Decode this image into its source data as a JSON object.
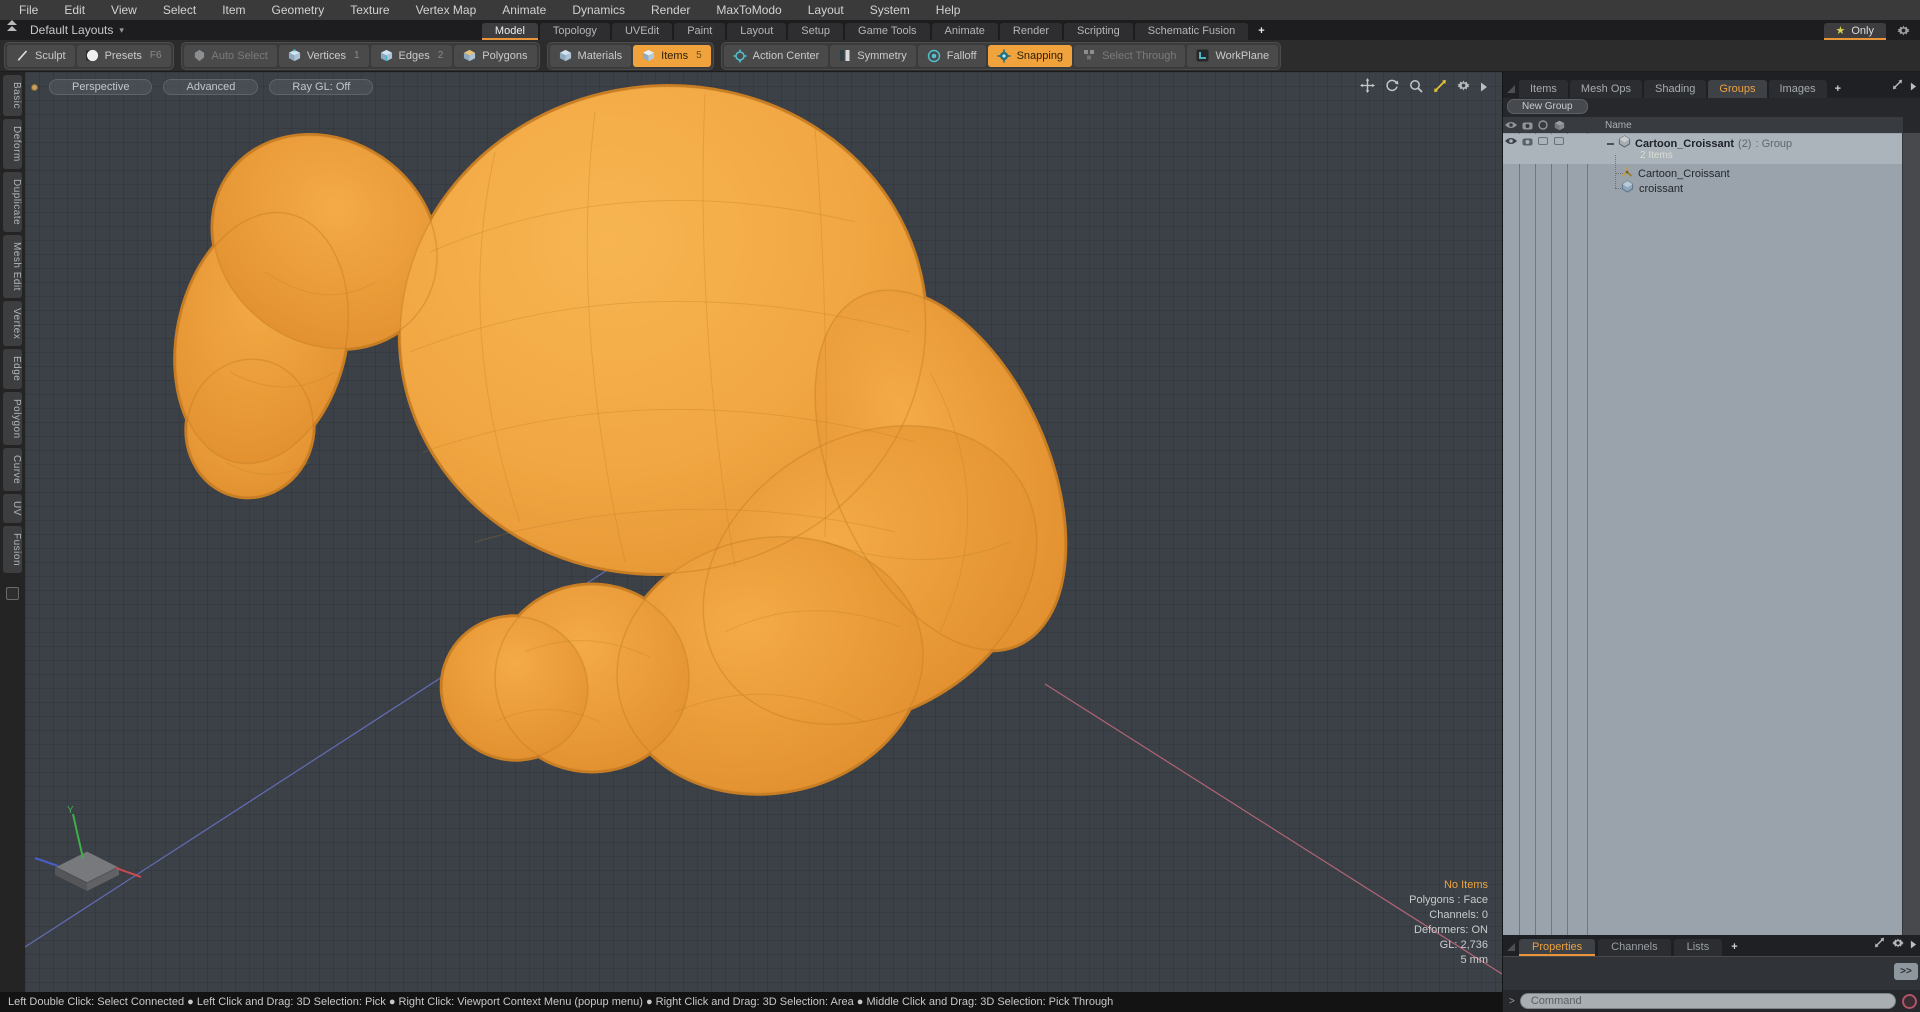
{
  "menubar": {
    "items": [
      "File",
      "Edit",
      "View",
      "Select",
      "Item",
      "Geometry",
      "Texture",
      "Vertex Map",
      "Animate",
      "Dynamics",
      "Render",
      "MaxToModo",
      "Layout",
      "System",
      "Help"
    ]
  },
  "layout_bar": {
    "layouts_label": "Default Layouts",
    "tabs": [
      "Model",
      "Topology",
      "UVEdit",
      "Paint",
      "Layout",
      "Setup",
      "Game Tools",
      "Animate",
      "Render",
      "Scripting",
      "Schematic Fusion"
    ],
    "add_tab_label": "+",
    "only_label": "Only"
  },
  "toolbar": {
    "buttons": [
      {
        "label": "Sculpt"
      },
      {
        "label": "Presets",
        "shortcut": "F6"
      },
      {
        "label": "Auto Select"
      },
      {
        "label": "Vertices",
        "shortcut": "1"
      },
      {
        "label": "Edges",
        "shortcut": "2"
      },
      {
        "label": "Polygons"
      },
      {
        "label": "Materials"
      },
      {
        "label": "Items",
        "shortcut": "5"
      },
      {
        "label": "Action Center"
      },
      {
        "label": "Symmetry"
      },
      {
        "label": "Falloff"
      },
      {
        "label": "Snapping"
      },
      {
        "label": "Select Through"
      },
      {
        "label": "WorkPlane"
      }
    ]
  },
  "left_tabs": {
    "items": [
      "Basic",
      "Deform",
      "Duplicate",
      "Mesh Edit",
      "Vertex",
      "Edge",
      "Polygon",
      "Curve",
      "UV",
      "Fusion"
    ]
  },
  "viewport": {
    "buttons": [
      "Perspective",
      "Advanced",
      "Ray GL: Off"
    ],
    "axis_y_label": "Y",
    "hud": {
      "selection": "No Items",
      "lines": [
        "Polygons : Face",
        "Channels: 0",
        "Deformers: ON",
        "GL: 2,736",
        "5 mm"
      ]
    }
  },
  "right_panel": {
    "tabs": [
      "Items",
      "Mesh Ops",
      "Shading",
      "Groups",
      "Images"
    ],
    "add_tab_label": "+",
    "new_group_label": "New Group",
    "name_column": "Name",
    "group_row": {
      "name": "Cartoon_Croissant",
      "count": "(2)",
      "type_suffix": ": Group",
      "summary": "2 Items"
    },
    "item_rows": [
      "Cartoon_Croissant",
      "croissant"
    ]
  },
  "properties_panel": {
    "tabs": [
      "Properties",
      "Channels",
      "Lists"
    ],
    "add_tab_label": "+",
    "expand_label": ">>",
    "command_placeholder": "Command"
  },
  "status_bar": {
    "text": "Left Double Click: Select Connected ● Left Click and Drag: 3D Selection: Pick ● Right Click: Viewport Context Menu (popup menu) ● Right Click and Drag: 3D Selection: Area ● Middle Click and Drag: 3D Selection: Pick Through"
  },
  "colors": {
    "accent_orange": "#f0a23c",
    "croissant_orange": "#f2a945",
    "viewport_bg": "#3b4147",
    "selection_row": "#abb3bb"
  }
}
